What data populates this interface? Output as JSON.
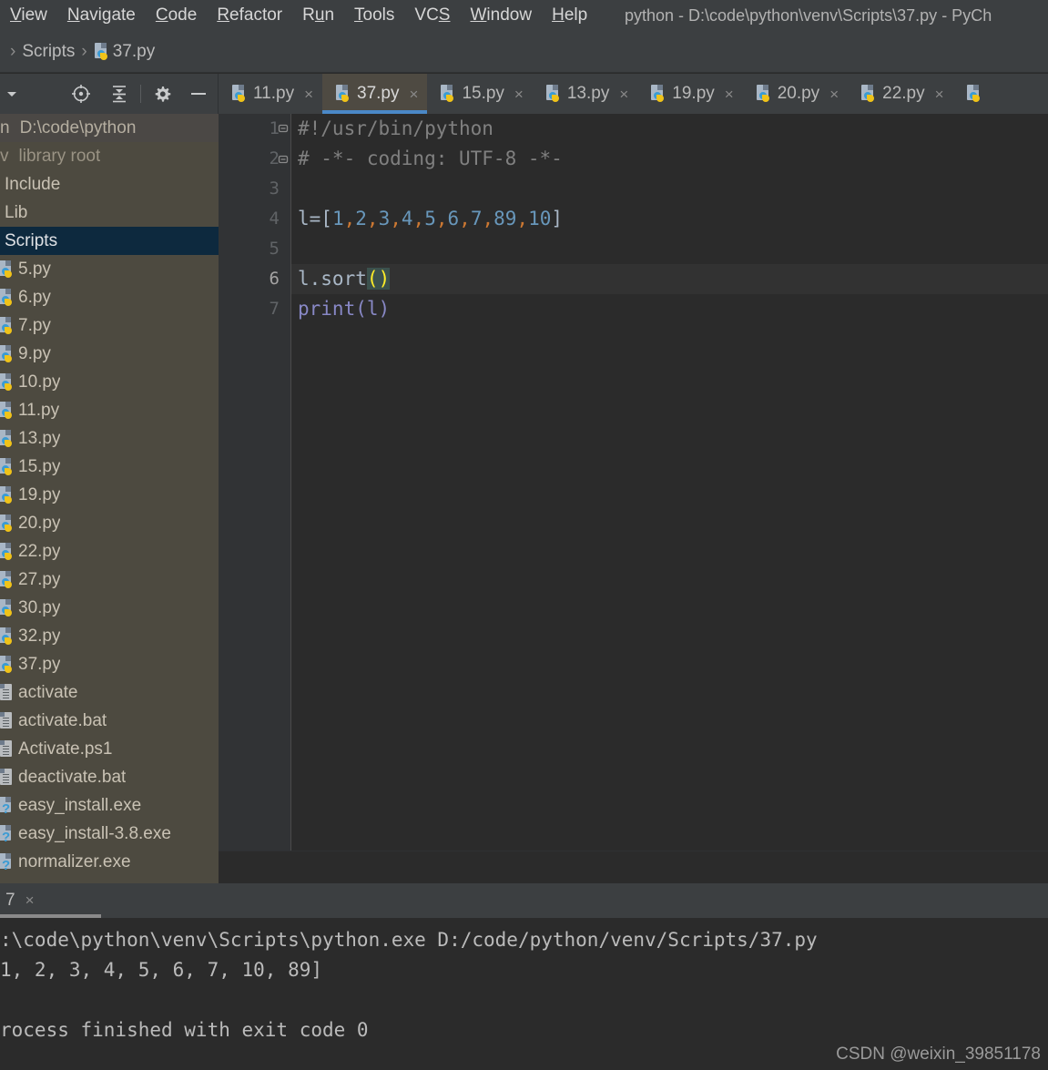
{
  "window": {
    "title": "python - D:\\code\\python\\venv\\Scripts\\37.py - PyCh"
  },
  "menubar": {
    "items": [
      {
        "label": "View",
        "mnemonic": "V",
        "rest": "iew"
      },
      {
        "label": "Navigate",
        "mnemonic": "N",
        "rest": "avigate"
      },
      {
        "label": "Code",
        "mnemonic": "C",
        "rest": "ode"
      },
      {
        "label": "Refactor",
        "mnemonic": "R",
        "rest": "efactor"
      },
      {
        "label": "Run",
        "mnemonic": "u",
        "pre": "R",
        "rest": "n"
      },
      {
        "label": "Tools",
        "mnemonic": "T",
        "rest": "ools"
      },
      {
        "label": "VCS",
        "mnemonic": "S",
        "pre": "VC",
        "rest": ""
      },
      {
        "label": "Window",
        "mnemonic": "W",
        "rest": "indow"
      },
      {
        "label": "Help",
        "mnemonic": "H",
        "rest": "elp"
      }
    ]
  },
  "breadcrumb": {
    "separator": "›",
    "folder": "Scripts",
    "file": "37.py",
    "file_icon": "python-file-icon"
  },
  "project_toolbar": {
    "icons": [
      {
        "name": "chevron-down-icon",
        "glyph": "▾"
      },
      {
        "name": "locate-target-icon",
        "glyph": "target"
      },
      {
        "name": "collapse-all-icon",
        "glyph": "collapse"
      },
      {
        "name": "gear-icon",
        "glyph": "gear"
      },
      {
        "name": "hide-panel-icon",
        "glyph": "minus"
      }
    ]
  },
  "project_tree": {
    "selected": "Scripts",
    "items": [
      {
        "label": "D:\\code\\python",
        "icon": "folder-root-icon",
        "kind": "root",
        "prefix": "n"
      },
      {
        "label": "library root",
        "icon": "folder-icon",
        "kind": "dim",
        "prefix": "v"
      },
      {
        "label": "Include",
        "icon": "folder-icon",
        "kind": "folder",
        "prefix": ""
      },
      {
        "label": "Lib",
        "icon": "folder-icon",
        "kind": "folder",
        "prefix": ""
      },
      {
        "label": "Scripts",
        "icon": "folder-icon",
        "kind": "folder-selected",
        "prefix": ""
      },
      {
        "label": "5.py",
        "icon": "python-file-icon",
        "kind": "py",
        "prefix": ""
      },
      {
        "label": "6.py",
        "icon": "python-file-icon",
        "kind": "py",
        "prefix": ""
      },
      {
        "label": "7.py",
        "icon": "python-file-icon",
        "kind": "py",
        "prefix": ""
      },
      {
        "label": "9.py",
        "icon": "python-file-icon",
        "kind": "py",
        "prefix": ""
      },
      {
        "label": "10.py",
        "icon": "python-file-icon",
        "kind": "py",
        "prefix": ""
      },
      {
        "label": "11.py",
        "icon": "python-file-icon",
        "kind": "py",
        "prefix": ""
      },
      {
        "label": "13.py",
        "icon": "python-file-icon",
        "kind": "py",
        "prefix": ""
      },
      {
        "label": "15.py",
        "icon": "python-file-icon",
        "kind": "py",
        "prefix": ""
      },
      {
        "label": "19.py",
        "icon": "python-file-icon",
        "kind": "py",
        "prefix": ""
      },
      {
        "label": "20.py",
        "icon": "python-file-icon",
        "kind": "py",
        "prefix": ""
      },
      {
        "label": "22.py",
        "icon": "python-file-icon",
        "kind": "py",
        "prefix": ""
      },
      {
        "label": "27.py",
        "icon": "python-file-icon",
        "kind": "py",
        "prefix": ""
      },
      {
        "label": "30.py",
        "icon": "python-file-icon",
        "kind": "py",
        "prefix": ""
      },
      {
        "label": "32.py",
        "icon": "python-file-icon",
        "kind": "py",
        "prefix": ""
      },
      {
        "label": "37.py",
        "icon": "python-file-icon",
        "kind": "py",
        "prefix": ""
      },
      {
        "label": "activate",
        "icon": "text-file-icon",
        "kind": "txt",
        "prefix": ""
      },
      {
        "label": "activate.bat",
        "icon": "text-file-icon",
        "kind": "txt",
        "prefix": ""
      },
      {
        "label": "Activate.ps1",
        "icon": "text-file-icon",
        "kind": "txt",
        "prefix": ""
      },
      {
        "label": "deactivate.bat",
        "icon": "text-file-icon",
        "kind": "txt",
        "prefix": ""
      },
      {
        "label": "easy_install.exe",
        "icon": "unknown-file-icon",
        "kind": "exe",
        "prefix": ""
      },
      {
        "label": "easy_install-3.8.exe",
        "icon": "unknown-file-icon",
        "kind": "exe",
        "prefix": ""
      },
      {
        "label": "normalizer.exe",
        "icon": "unknown-file-icon",
        "kind": "exe",
        "prefix": ""
      }
    ]
  },
  "editor_tabs": {
    "active": "37.py",
    "close_glyph": "×",
    "items": [
      {
        "label": "11.py",
        "active": false
      },
      {
        "label": "37.py",
        "active": true
      },
      {
        "label": "15.py",
        "active": false
      },
      {
        "label": "13.py",
        "active": false
      },
      {
        "label": "19.py",
        "active": false
      },
      {
        "label": "20.py",
        "active": false
      },
      {
        "label": "22.py",
        "active": false
      }
    ]
  },
  "editor": {
    "current_line": 6,
    "line_numbers": [
      "1",
      "2",
      "3",
      "4",
      "5",
      "6",
      "7"
    ],
    "lines": [
      {
        "n": "1",
        "text": "#!/usr/bin/python"
      },
      {
        "n": "2",
        "text": "# -*- coding: UTF-8 -*-"
      },
      {
        "n": "3",
        "text": ""
      },
      {
        "n": "4",
        "text": "l=[1,2,3,4,5,6,7,89,10]"
      },
      {
        "n": "5",
        "text": ""
      },
      {
        "n": "6",
        "text": "l.sort()"
      },
      {
        "n": "7",
        "text": "print(l)"
      }
    ],
    "list_values": [
      "1",
      "2",
      "3",
      "4",
      "5",
      "6",
      "7",
      "89",
      "10"
    ],
    "sort_call": "l.sort",
    "sort_parens": "()",
    "print_call": "print",
    "print_arg": "l"
  },
  "run_window": {
    "tab_label": "7",
    "close_glyph": "×",
    "console_lines": [
      ":\\code\\python\\venv\\Scripts\\python.exe D:/code/python/venv/Scripts/37.py",
      "1, 2, 3, 4, 5, 6, 7, 10, 89]",
      "",
      "rocess finished with exit code 0"
    ]
  },
  "watermark": {
    "text": "CSDN @weixin_39851178"
  },
  "colors": {
    "editor_bg": "#2b2b2b",
    "panel_bg": "#3c3f41",
    "project_bg": "#4d4a40",
    "selection_bg": "#0d293e",
    "active_tab_underline": "#4a88c7",
    "brace_highlight_bg": "#3b514d",
    "brace_highlight_fg": "#ffef28",
    "number_literal": "#6897bb",
    "punctuation": "#cc7832",
    "comment": "#808080"
  }
}
